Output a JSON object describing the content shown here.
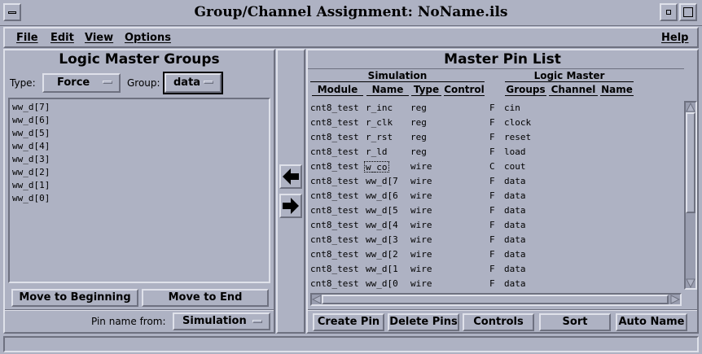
{
  "window": {
    "title": "Group/Channel Assignment: NoName.ils"
  },
  "menu": {
    "file": "File",
    "edit": "Edit",
    "view": "View",
    "options": "Options",
    "help": "Help"
  },
  "left": {
    "title": "Logic Master Groups",
    "type_label": "Type:",
    "type_value": "Force",
    "group_label": "Group:",
    "group_value": "data",
    "items": [
      "ww_d[7]",
      "ww_d[6]",
      "ww_d[5]",
      "ww_d[4]",
      "ww_d[3]",
      "ww_d[2]",
      "ww_d[1]",
      "ww_d[0]"
    ],
    "move_beginning": "Move to Beginning",
    "move_end": "Move to End",
    "pin_name_label": "Pin name from:",
    "pin_name_value": "Simulation"
  },
  "right": {
    "title": "Master Pin List",
    "sim_header": "Simulation",
    "lm_header": "Logic Master",
    "cols": {
      "module": "Module",
      "name": "Name",
      "type": "Type",
      "control": "Control",
      "groups": "Groups",
      "channel": "Channel",
      "lm_name": "Name"
    },
    "rows": [
      {
        "module": "cnt8_test",
        "name": "r_inc",
        "type": "reg",
        "control": "F",
        "group": "cin"
      },
      {
        "module": "cnt8_test",
        "name": "r_clk",
        "type": "reg",
        "control": "F",
        "group": "clock"
      },
      {
        "module": "cnt8_test",
        "name": "r_rst",
        "type": "reg",
        "control": "F",
        "group": "reset"
      },
      {
        "module": "cnt8_test",
        "name": "r_ld",
        "type": "reg",
        "control": "F",
        "group": "load"
      },
      {
        "module": "cnt8_test",
        "name": "w_co",
        "type": "wire",
        "control": "C",
        "group": "cout"
      },
      {
        "module": "cnt8_test",
        "name": "ww_d[7",
        "type": "wire",
        "control": "F",
        "group": "data"
      },
      {
        "module": "cnt8_test",
        "name": "ww_d[6",
        "type": "wire",
        "control": "F",
        "group": "data"
      },
      {
        "module": "cnt8_test",
        "name": "ww_d[5",
        "type": "wire",
        "control": "F",
        "group": "data"
      },
      {
        "module": "cnt8_test",
        "name": "ww_d[4",
        "type": "wire",
        "control": "F",
        "group": "data"
      },
      {
        "module": "cnt8_test",
        "name": "ww_d[3",
        "type": "wire",
        "control": "F",
        "group": "data"
      },
      {
        "module": "cnt8_test",
        "name": "ww_d[2",
        "type": "wire",
        "control": "F",
        "group": "data"
      },
      {
        "module": "cnt8_test",
        "name": "ww_d[1",
        "type": "wire",
        "control": "F",
        "group": "data"
      },
      {
        "module": "cnt8_test",
        "name": "ww_d[0",
        "type": "wire",
        "control": "F",
        "group": "data"
      }
    ],
    "buttons": {
      "create": "Create Pin",
      "delete": "Delete Pins",
      "controls": "Controls",
      "sort": "Sort",
      "auto": "Auto Name"
    }
  },
  "icons": {
    "move_left": "arrow-left-icon",
    "move_right": "arrow-right-icon"
  },
  "colors": {
    "background": "#aeb2c3",
    "highlight": "#dfe1ea",
    "shadow": "#6e7180"
  }
}
